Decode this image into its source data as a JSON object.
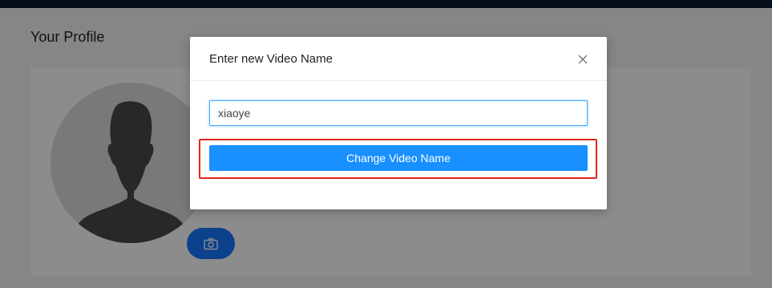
{
  "page": {
    "title": "Your Profile"
  },
  "profile": {
    "avatar_icon": "user-silhouette-icon",
    "camera_icon": "camera-icon"
  },
  "modal": {
    "title": "Enter new Video Name",
    "close_icon": "close-icon",
    "input_value": "xiaoye",
    "submit_label": "Change Video Name",
    "annotation": "highlight-box"
  },
  "colors": {
    "top_bar": "#0c1a33",
    "primary": "#1890ff",
    "highlight": "#e3261c",
    "avatar_bg": "#dcdcdc",
    "avatar_figure": "#4a4a4a"
  }
}
